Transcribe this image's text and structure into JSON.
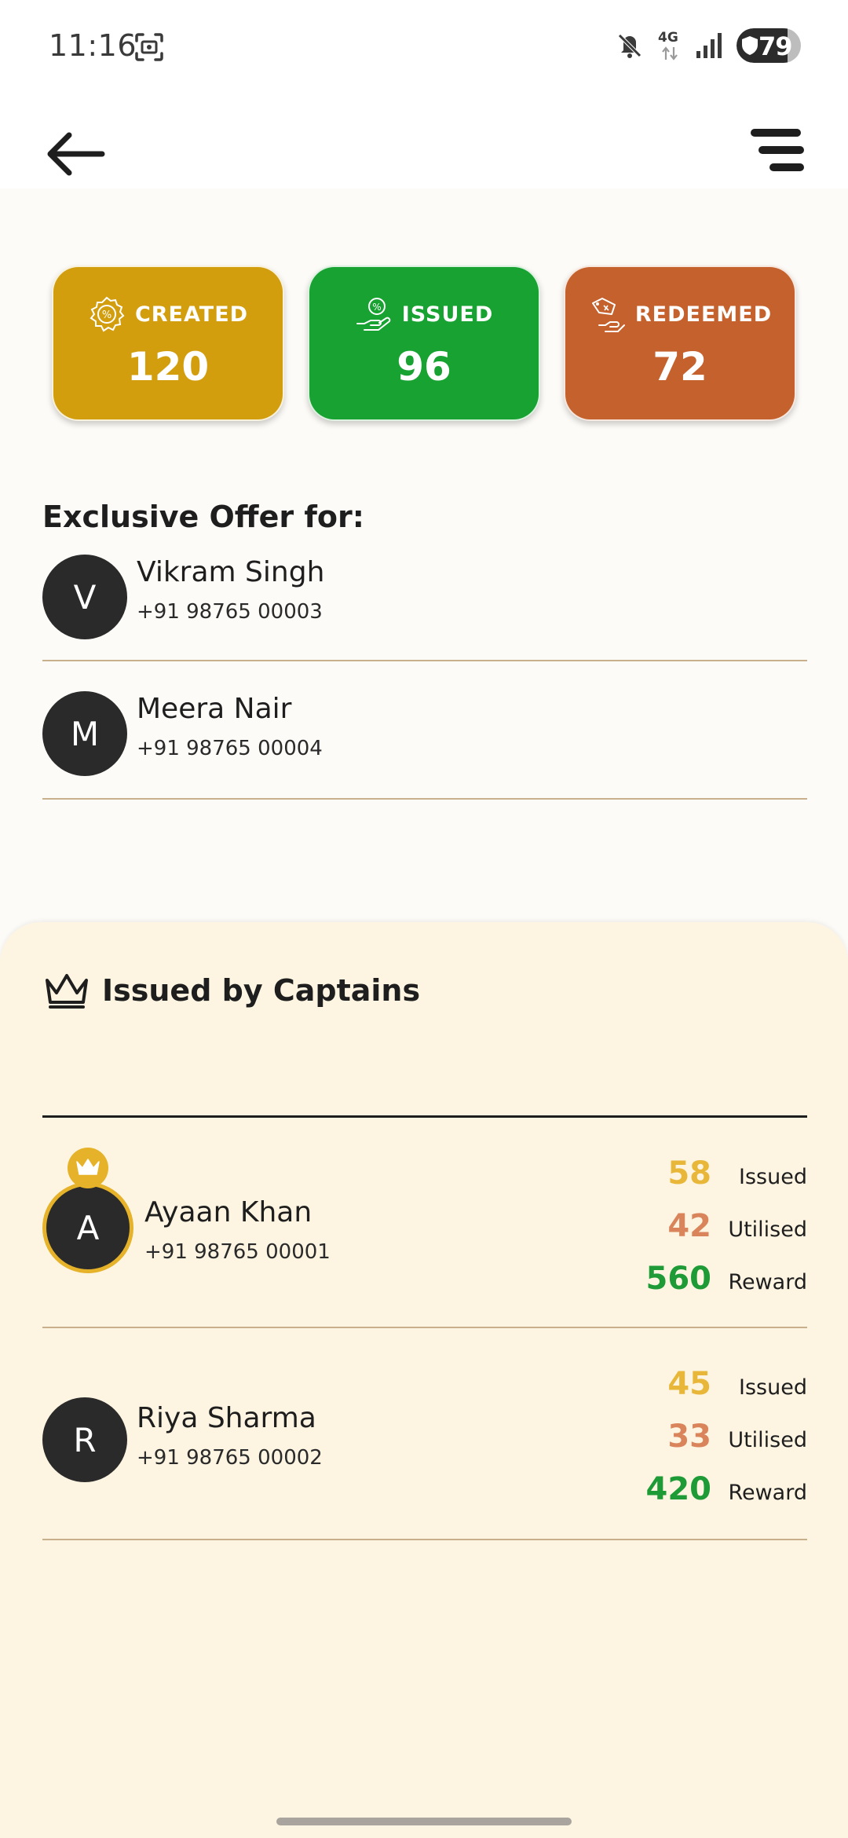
{
  "status_bar": {
    "time": "11:16",
    "network": "4G",
    "battery": "79",
    "battery_level_percent": 79
  },
  "header": {
    "back_icon": "arrow-left-icon",
    "menu_icon": "menu-icon"
  },
  "stats": [
    {
      "label": "CREATED",
      "value": "120",
      "color": "#D29E0E",
      "icon": "percent-badge-icon"
    },
    {
      "label": "ISSUED",
      "value": "96",
      "color": "#18A232",
      "icon": "hand-coin-icon"
    },
    {
      "label": "REDEEMED",
      "value": "72",
      "color": "#C4612C",
      "icon": "hand-tag-icon"
    }
  ],
  "offer": {
    "title": "Exclusive Offer for:",
    "people": [
      {
        "initial": "V",
        "name": "Vikram Singh",
        "phone": "+91 98765 00003"
      },
      {
        "initial": "M",
        "name": "Meera Nair",
        "phone": "+91 98765 00004"
      }
    ]
  },
  "captains": {
    "title": "Issued by Captains",
    "icon": "crown-icon",
    "list": [
      {
        "initial": "A",
        "name": "Ayaan Khan",
        "phone": "+91 98765 00001",
        "top_badge": "crown-icon",
        "issued": "58",
        "utilised": "42",
        "reward": "560",
        "issued_label": "Issued",
        "utilised_label": "Utilised",
        "reward_label": "Reward"
      },
      {
        "initial": "R",
        "name": "Riya Sharma",
        "phone": "+91 98765 00002",
        "issued": "45",
        "utilised": "33",
        "reward": "420",
        "issued_label": "Issued",
        "utilised_label": "Utilised",
        "reward_label": "Reward"
      }
    ]
  },
  "colors": {
    "accent_gold": "#E5B229",
    "issued_text": "#E8B73A",
    "utilised_text": "#D9845A",
    "reward_text": "#1E9A36",
    "sheet_background": "#FDF5E2"
  }
}
